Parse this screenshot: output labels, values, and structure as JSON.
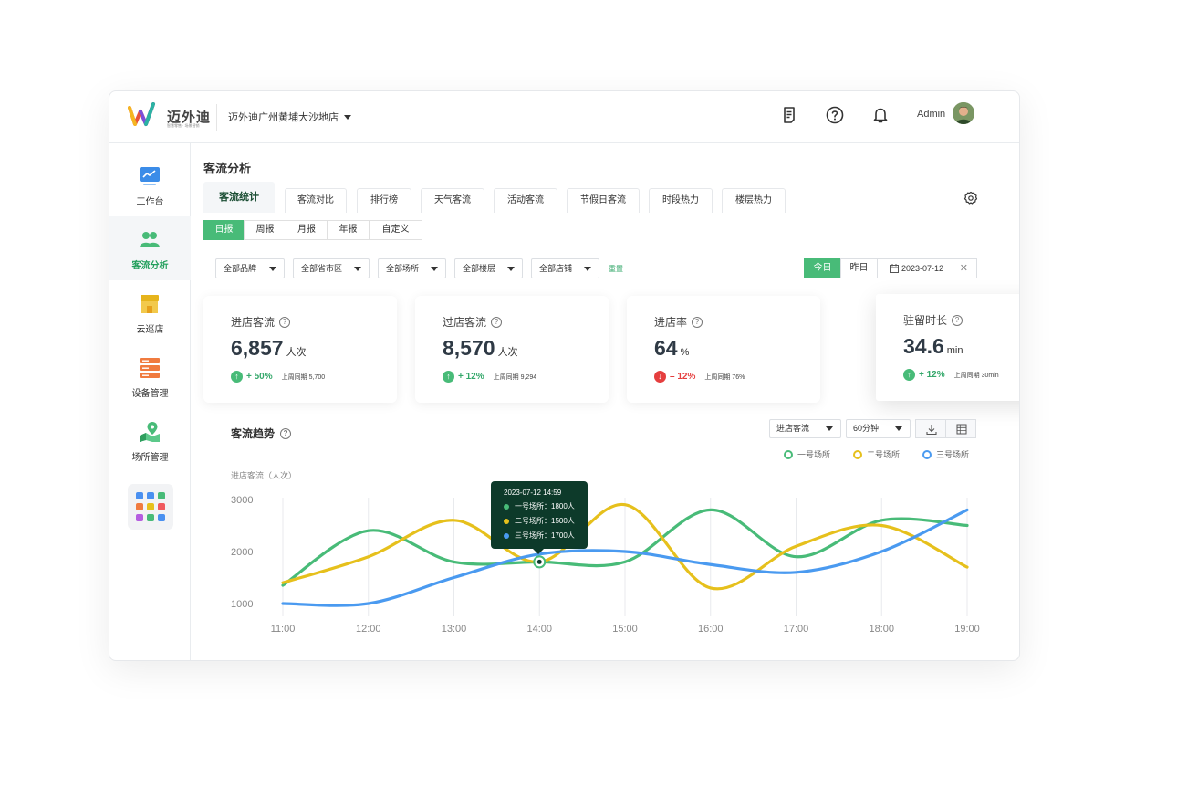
{
  "app": {
    "logo_text": "迈外迪",
    "logo_sub": "智慧零售 · 场景营销",
    "store_name": "迈外迪广州黄埔大沙地店"
  },
  "header": {
    "user_name": "Admin"
  },
  "sidebar": {
    "items": [
      {
        "label": "工作台",
        "icon": "monitor-chart-icon"
      },
      {
        "label": "客流分析",
        "icon": "people-icon",
        "active": true
      },
      {
        "label": "云巡店",
        "icon": "store-icon"
      },
      {
        "label": "设备管理",
        "icon": "server-icon"
      },
      {
        "label": "场所管理",
        "icon": "location-icon"
      }
    ]
  },
  "page": {
    "title": "客流分析"
  },
  "tabs": [
    "客流统计",
    "客流对比",
    "排行榜",
    "天气客流",
    "活动客流",
    "节假日客流",
    "时段热力",
    "楼层热力"
  ],
  "periods": [
    "日报",
    "周报",
    "月报",
    "年报",
    "自定义"
  ],
  "filters": [
    "全部品牌",
    "全部省市区",
    "全部场所",
    "全部楼层",
    "全部店铺"
  ],
  "reset_label": "重置",
  "date_buttons": [
    "今日",
    "昨日"
  ],
  "date_value": "2023-07-12",
  "date_clear": "✕",
  "cards": [
    {
      "title": "进店客流",
      "value": "6,857",
      "unit": "人次",
      "delta": "+ 50%",
      "direction": "up",
      "compare": "上周同期 5,700"
    },
    {
      "title": "过店客流",
      "value": "8,570",
      "unit": "人次",
      "delta": "+ 12%",
      "direction": "up",
      "compare": "上周同期 9,294"
    },
    {
      "title": "进店率",
      "value": "64",
      "unit": "%",
      "delta": "– 12%",
      "direction": "down",
      "compare": "上周同期 76%"
    },
    {
      "title": "驻留时长",
      "value": "34.6",
      "unit": "min",
      "delta": "+ 12%",
      "direction": "up",
      "compare": "上周同期 30min"
    }
  ],
  "trend": {
    "title": "客流趋势",
    "metric_select": "进店客流",
    "interval_select": "60分钟"
  },
  "colors": {
    "green": "#48bb78",
    "yellow": "#e6c01c",
    "blue": "#4a9af0",
    "tooltip_bg": "#0d3a2a"
  },
  "chart_data": {
    "type": "line",
    "ylabel": "进店客流（人次）",
    "x": [
      "11:00",
      "12:00",
      "13:00",
      "14:00",
      "15:00",
      "16:00",
      "17:00",
      "18:00",
      "19:00"
    ],
    "y_ticks": [
      1000,
      2000,
      3000
    ],
    "series": [
      {
        "name": "一号场所",
        "color": "#48bb78",
        "values": [
          1350,
          2400,
          1800,
          1800,
          1800,
          2800,
          1900,
          2600,
          2500
        ]
      },
      {
        "name": "二号场所",
        "color": "#e6c01c",
        "values": [
          1400,
          1900,
          2600,
          1800,
          2900,
          1300,
          2100,
          2500,
          1700
        ]
      },
      {
        "name": "三号场所",
        "color": "#4a9af0",
        "values": [
          1000,
          1000,
          1500,
          1950,
          2000,
          1750,
          1600,
          2000,
          2800
        ]
      }
    ],
    "tooltip": {
      "title": "2023-07-12  14:59",
      "rows": [
        "一号场所：1800人",
        "二号场所：1500人",
        "三号场所：1700人"
      ]
    }
  }
}
